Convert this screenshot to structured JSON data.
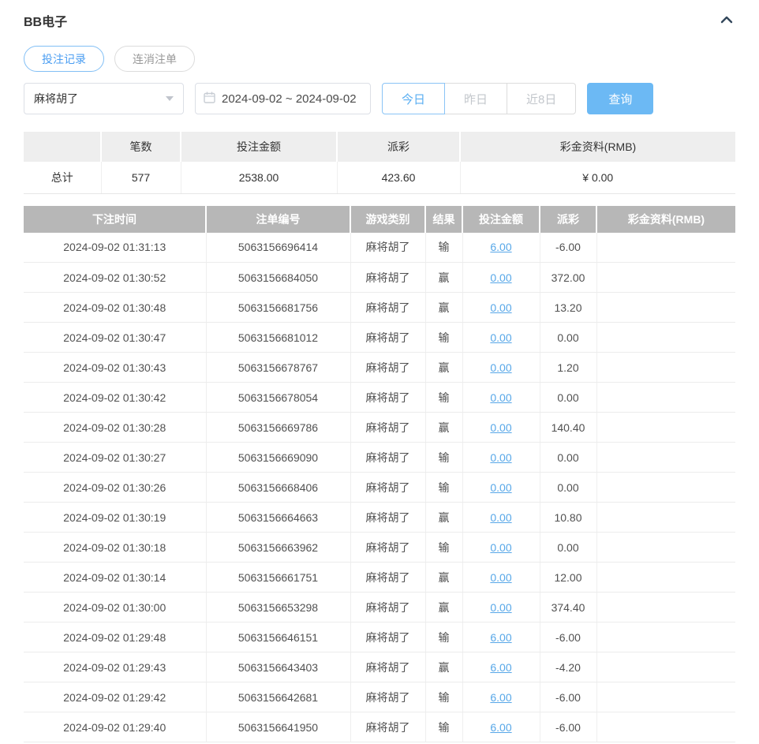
{
  "page": {
    "title": "BB电子"
  },
  "icons": {
    "collapse": "chevron-up-icon",
    "calendar": "calendar-icon",
    "select_caret": "chevron-down-icon"
  },
  "tabs": [
    {
      "label": "投注记录",
      "active": true
    },
    {
      "label": "连消注单",
      "active": false
    }
  ],
  "filters": {
    "game_select": {
      "value": "麻将胡了"
    },
    "date_range": {
      "value": "2024-09-02 ~ 2024-09-02"
    },
    "quick_buttons": [
      {
        "label": "今日",
        "active": true
      },
      {
        "label": "昨日",
        "active": false
      },
      {
        "label": "近8日",
        "active": false
      }
    ],
    "search_label": "查询"
  },
  "summary": {
    "headers": [
      "",
      "笔数",
      "投注金额",
      "派彩",
      "彩金资料(RMB)"
    ],
    "row": {
      "label": "总计",
      "count": "577",
      "bet_amount": "2538.00",
      "payout": "423.60",
      "bonus": "¥ 0.00"
    }
  },
  "table": {
    "headers": [
      "下注时间",
      "注单编号",
      "游戏类别",
      "结果",
      "投注金额",
      "派彩",
      "彩金资料(RMB)"
    ],
    "rows": [
      {
        "time": "2024-09-02 01:31:13",
        "id": "5063156696414",
        "game": "麻将胡了",
        "result": "输",
        "bet": "6.00",
        "payout": "-6.00",
        "bonus": ""
      },
      {
        "time": "2024-09-02 01:30:52",
        "id": "5063156684050",
        "game": "麻将胡了",
        "result": "赢",
        "bet": "0.00",
        "payout": "372.00",
        "bonus": ""
      },
      {
        "time": "2024-09-02 01:30:48",
        "id": "5063156681756",
        "game": "麻将胡了",
        "result": "赢",
        "bet": "0.00",
        "payout": "13.20",
        "bonus": ""
      },
      {
        "time": "2024-09-02 01:30:47",
        "id": "5063156681012",
        "game": "麻将胡了",
        "result": "输",
        "bet": "0.00",
        "payout": "0.00",
        "bonus": ""
      },
      {
        "time": "2024-09-02 01:30:43",
        "id": "5063156678767",
        "game": "麻将胡了",
        "result": "赢",
        "bet": "0.00",
        "payout": "1.20",
        "bonus": ""
      },
      {
        "time": "2024-09-02 01:30:42",
        "id": "5063156678054",
        "game": "麻将胡了",
        "result": "输",
        "bet": "0.00",
        "payout": "0.00",
        "bonus": ""
      },
      {
        "time": "2024-09-02 01:30:28",
        "id": "5063156669786",
        "game": "麻将胡了",
        "result": "赢",
        "bet": "0.00",
        "payout": "140.40",
        "bonus": ""
      },
      {
        "time": "2024-09-02 01:30:27",
        "id": "5063156669090",
        "game": "麻将胡了",
        "result": "输",
        "bet": "0.00",
        "payout": "0.00",
        "bonus": ""
      },
      {
        "time": "2024-09-02 01:30:26",
        "id": "5063156668406",
        "game": "麻将胡了",
        "result": "输",
        "bet": "0.00",
        "payout": "0.00",
        "bonus": ""
      },
      {
        "time": "2024-09-02 01:30:19",
        "id": "5063156664663",
        "game": "麻将胡了",
        "result": "赢",
        "bet": "0.00",
        "payout": "10.80",
        "bonus": ""
      },
      {
        "time": "2024-09-02 01:30:18",
        "id": "5063156663962",
        "game": "麻将胡了",
        "result": "输",
        "bet": "0.00",
        "payout": "0.00",
        "bonus": ""
      },
      {
        "time": "2024-09-02 01:30:14",
        "id": "5063156661751",
        "game": "麻将胡了",
        "result": "赢",
        "bet": "0.00",
        "payout": "12.00",
        "bonus": ""
      },
      {
        "time": "2024-09-02 01:30:00",
        "id": "5063156653298",
        "game": "麻将胡了",
        "result": "赢",
        "bet": "0.00",
        "payout": "374.40",
        "bonus": ""
      },
      {
        "time": "2024-09-02 01:29:48",
        "id": "5063156646151",
        "game": "麻将胡了",
        "result": "输",
        "bet": "6.00",
        "payout": "-6.00",
        "bonus": ""
      },
      {
        "time": "2024-09-02 01:29:43",
        "id": "5063156643403",
        "game": "麻将胡了",
        "result": "赢",
        "bet": "6.00",
        "payout": "-4.20",
        "bonus": ""
      },
      {
        "time": "2024-09-02 01:29:42",
        "id": "5063156642681",
        "game": "麻将胡了",
        "result": "输",
        "bet": "6.00",
        "payout": "-6.00",
        "bonus": ""
      },
      {
        "time": "2024-09-02 01:29:40",
        "id": "5063156641950",
        "game": "麻将胡了",
        "result": "输",
        "bet": "6.00",
        "payout": "-6.00",
        "bonus": ""
      }
    ]
  },
  "colors": {
    "accent_blue": "#59aef2",
    "search_button_bg": "#6cb9f4",
    "link_blue": "#57a7e8",
    "negative_red": "#e05c5c",
    "table_header_bg": "#b7b7b7",
    "summary_header_bg": "#eeeeee"
  }
}
